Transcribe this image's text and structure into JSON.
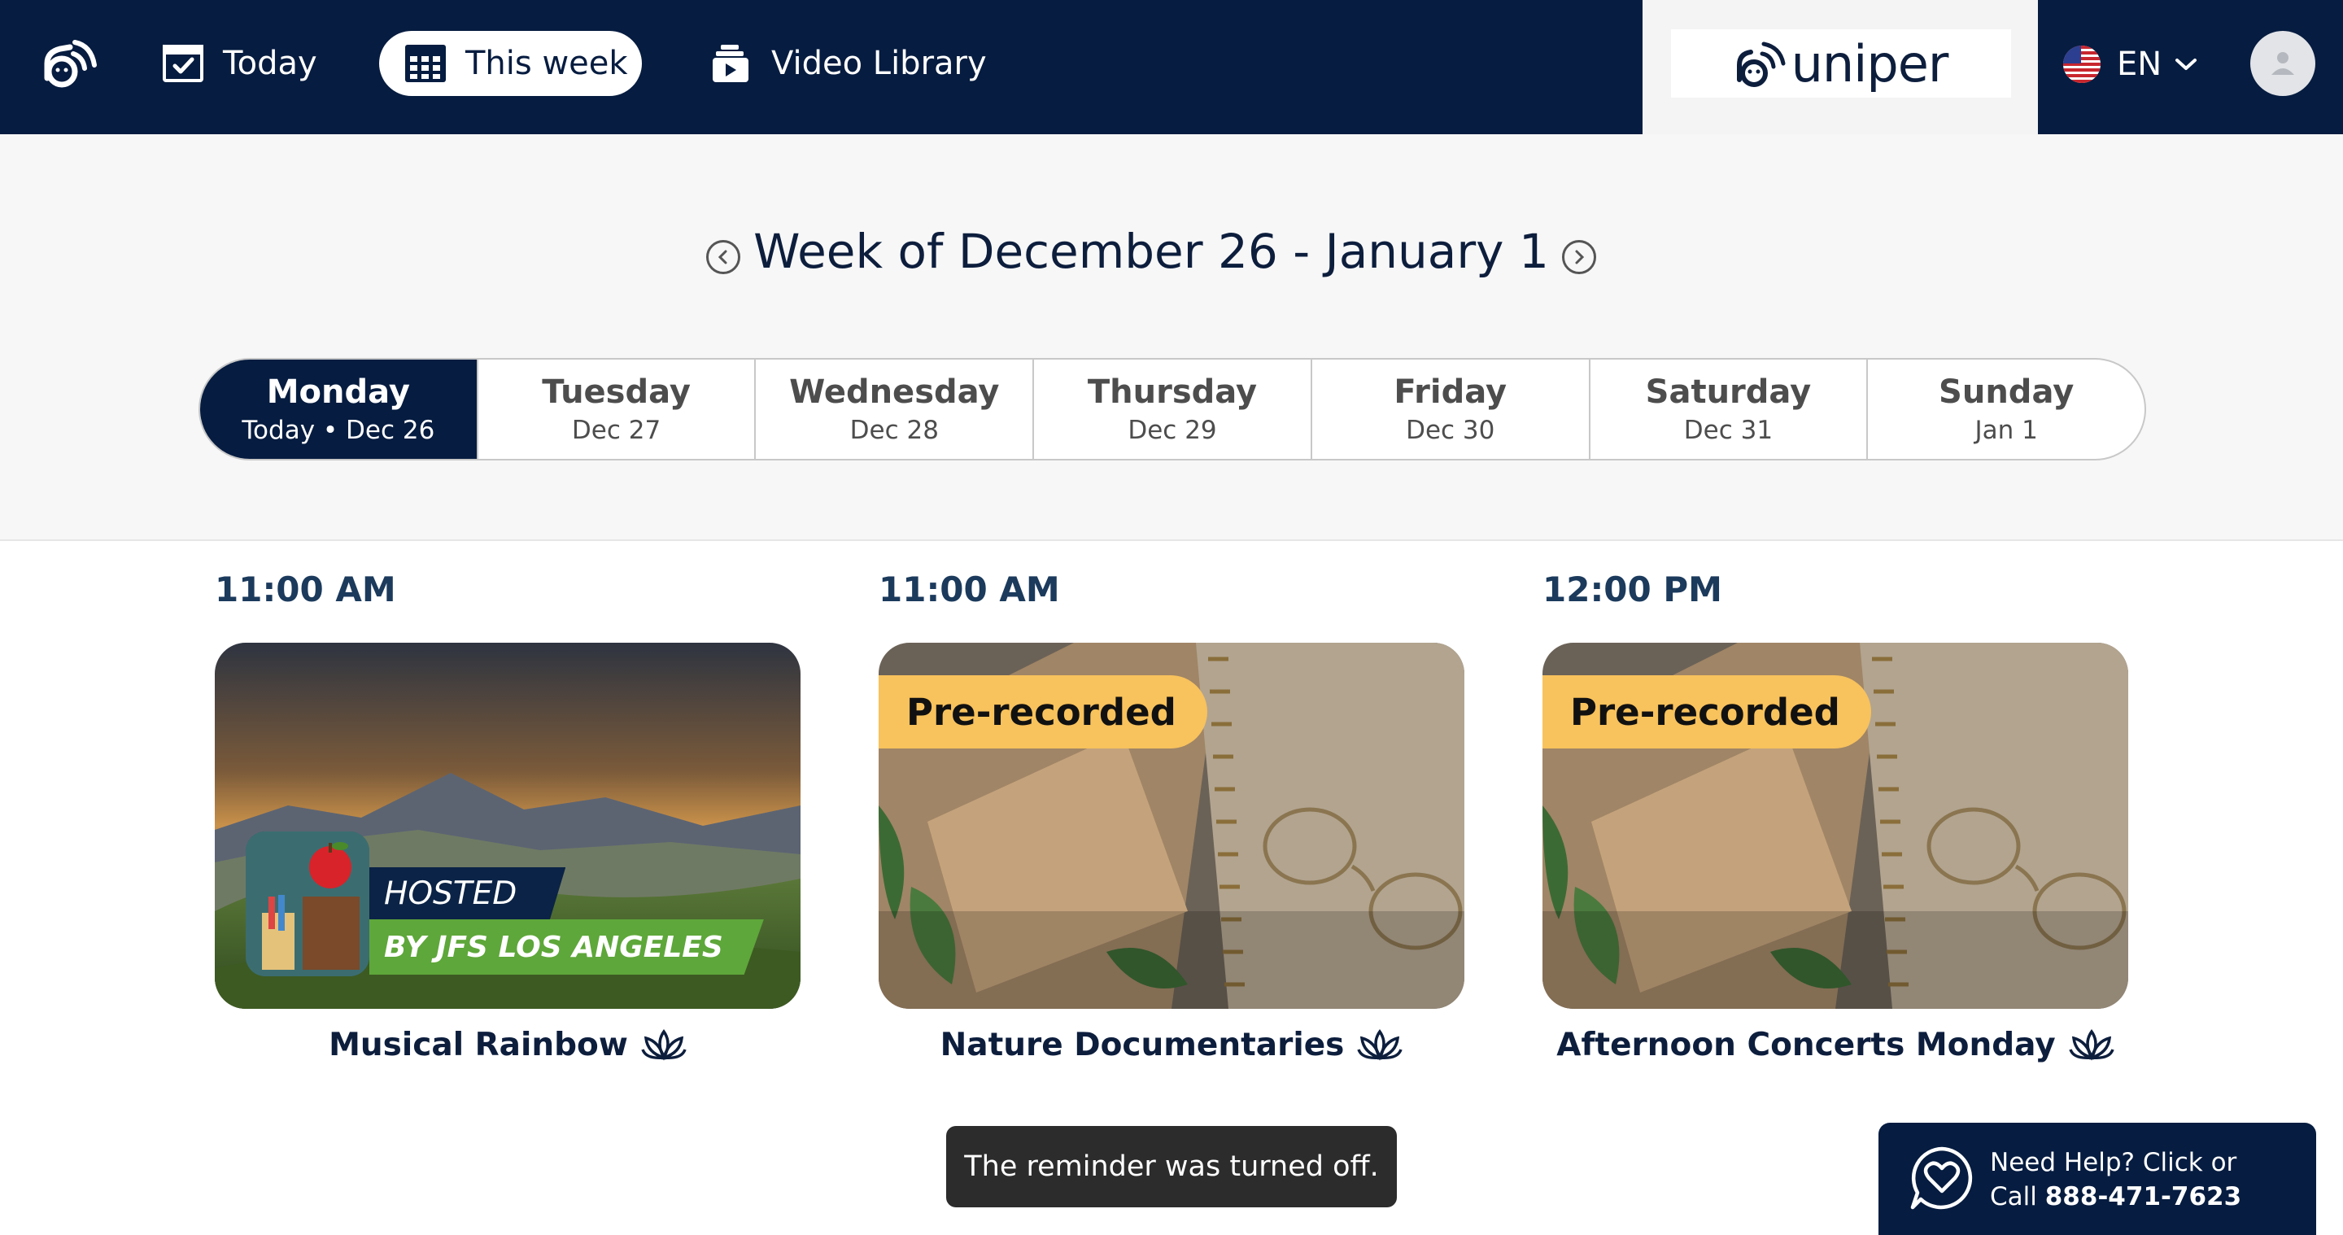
{
  "nav": {
    "today_label": "Today",
    "week_label": "This week",
    "library_label": "Video Library",
    "brand": "uniper",
    "language": "EN"
  },
  "week": {
    "title": "Week of December 26 - January 1",
    "days": [
      {
        "name": "Monday",
        "date": "Today • Dec 26",
        "active": true
      },
      {
        "name": "Tuesday",
        "date": "Dec 27"
      },
      {
        "name": "Wednesday",
        "date": "Dec 28"
      },
      {
        "name": "Thursday",
        "date": "Dec 29"
      },
      {
        "name": "Friday",
        "date": "Dec 30"
      },
      {
        "name": "Saturday",
        "date": "Dec 31"
      },
      {
        "name": "Sunday",
        "date": "Jan 1"
      }
    ]
  },
  "events": [
    {
      "time": "11:00 AM",
      "title": "Musical Rainbow",
      "hosted_line1": "HOSTED",
      "hosted_line2": "BY JFS LOS ANGELES"
    },
    {
      "time": "11:00 AM",
      "title": "Nature Documentaries",
      "badge": "Pre-recorded"
    },
    {
      "time": "12:00 PM",
      "title": "Afternoon Concerts Monday",
      "badge": "Pre-recorded"
    }
  ],
  "toast": "The reminder was turned off.",
  "help": {
    "line1": "Need Help? Click or",
    "line2_prefix": "Call ",
    "phone": "888-471-7623"
  },
  "colors": {
    "navy": "#061c40",
    "badge": "#f8c25c",
    "green": "#5ea73a"
  }
}
